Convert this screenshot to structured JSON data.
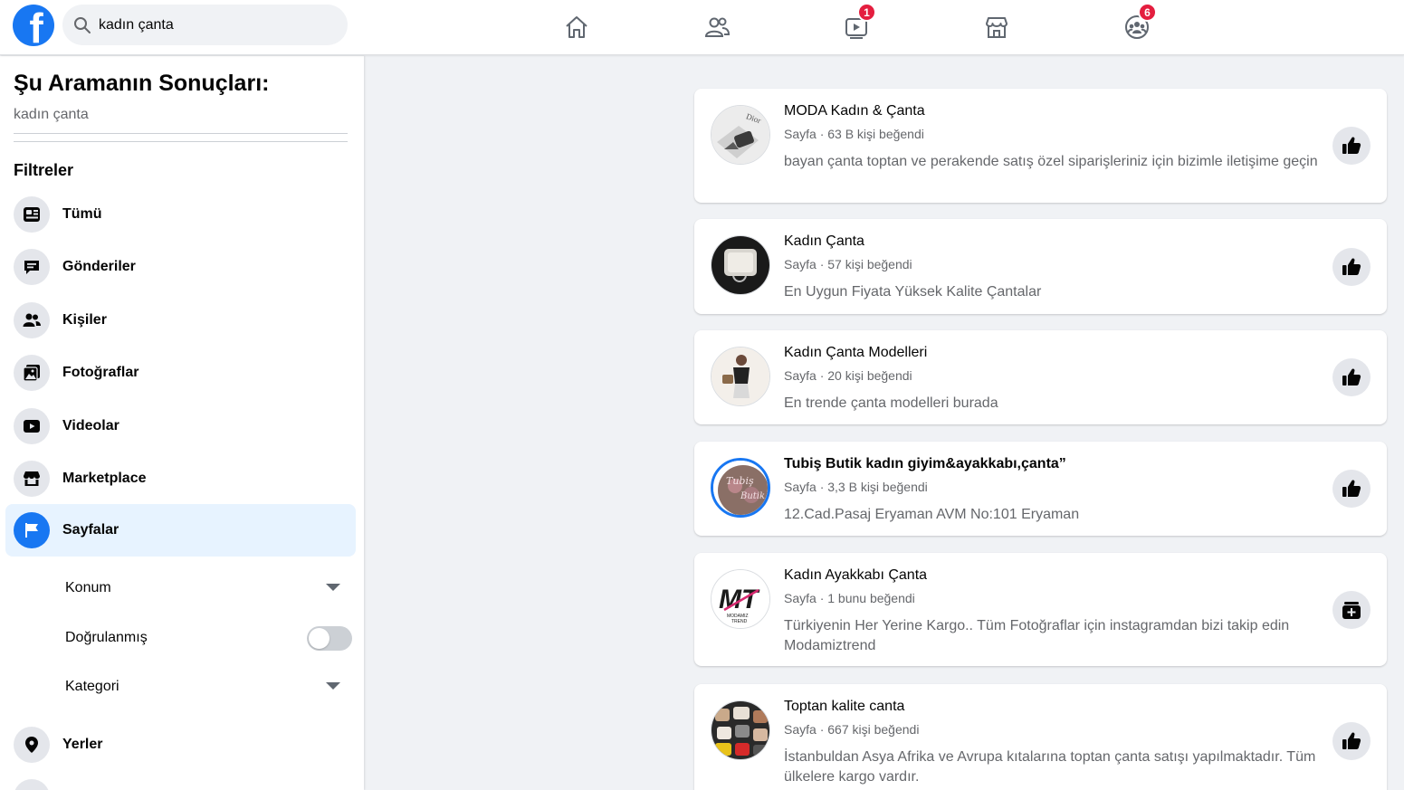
{
  "search": {
    "value": "kadın çanta"
  },
  "nav": {
    "watch_badge": "1",
    "groups_badge": "6"
  },
  "sidebar": {
    "title": "Şu Aramanın Sonuçları:",
    "query": "kadın çanta",
    "filters_title": "Filtreler",
    "items": [
      {
        "label": "Tümü",
        "icon": "feed-icon"
      },
      {
        "label": "Gönderiler",
        "icon": "posts-icon"
      },
      {
        "label": "Kişiler",
        "icon": "people-icon"
      },
      {
        "label": "Fotoğraflar",
        "icon": "photos-icon"
      },
      {
        "label": "Videolar",
        "icon": "video-icon"
      },
      {
        "label": "Marketplace",
        "icon": "marketplace-icon"
      },
      {
        "label": "Sayfalar",
        "icon": "flag-icon",
        "active": true
      },
      {
        "label": "Yerler",
        "icon": "location-icon"
      }
    ],
    "sub_filters": {
      "location": "Konum",
      "verified": "Doğrulanmış",
      "category": "Kategori"
    }
  },
  "results": [
    {
      "title": "MODA Kadın & Çanta",
      "meta": "Sayfa · 63 B kişi beğendi",
      "desc": "bayan çanta toptan ve perakende satış özel siparişleriniz için bizimle iletişime geçin",
      "action": "like-icon"
    },
    {
      "title": "Kadın Çanta",
      "meta": "Sayfa · 57 kişi beğendi",
      "desc": "En Uygun Fiyata Yüksek Kalite Çantalar",
      "action": "like-icon"
    },
    {
      "title": "Kadın Çanta Modelleri",
      "meta": "Sayfa · 20 kişi beğendi",
      "desc": "En trende çanta modelleri burada",
      "action": "like-icon"
    },
    {
      "title": "Tubiş Butik kadın giyim&ayakkabı,çanta”",
      "meta": "Sayfa · 3,3 B kişi beğendi",
      "desc": "12.Cad.Pasaj Eryaman AVM No:101 Eryaman",
      "action": "like-icon"
    },
    {
      "title": "Kadın Ayakkabı Çanta",
      "meta": "Sayfa · 1 bunu beğendi",
      "desc": "Türkiyenin Her Yerine Kargo.. Tüm Fotoğraflar için instagramdan bizi takip edin Modamiztrend",
      "action": "join-icon"
    },
    {
      "title": "Toptan kalite canta",
      "meta": "Sayfa · 667 kişi beğendi",
      "desc": "İstanbuldan Asya Afrika ve Avrupa kıtalarına toptan çanta satışı yapılmaktadır. Tüm ülkelere kargo vardır.",
      "action": "like-icon"
    }
  ],
  "colors": {
    "brand": "#1877f2",
    "badge": "#e41e3f",
    "active_bg": "#e7f3ff"
  }
}
